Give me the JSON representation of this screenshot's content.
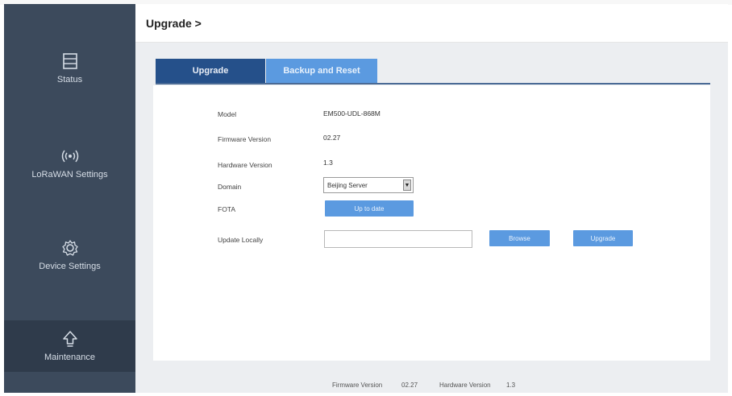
{
  "header": {
    "title": "Upgrade >"
  },
  "sidebar": {
    "items": [
      {
        "label": "Status",
        "icon": "status-icon"
      },
      {
        "label": "LoRaWAN Settings",
        "icon": "wireless-icon"
      },
      {
        "label": "Device Settings",
        "icon": "gear-icon"
      },
      {
        "label": "Maintenance",
        "icon": "upgrade-arrow-icon",
        "active": true
      }
    ]
  },
  "tabs": [
    {
      "label": "Upgrade",
      "active": true
    },
    {
      "label": "Backup and Reset",
      "active": false
    }
  ],
  "form": {
    "model_label": "Model",
    "model_value": "EM500-UDL-868M",
    "firmware_label": "Firmware Version",
    "firmware_value": "02.27",
    "hardware_label": "Hardware Version",
    "hardware_value": "1.3",
    "domain_label": "Domain",
    "domain_value": "Beijing Server",
    "fota_label": "FOTA",
    "fota_button": "Up to date",
    "update_label": "Update Locally",
    "browse_button": "Browse",
    "upgrade_button": "Upgrade"
  },
  "footer": {
    "firmware_label": "Firmware Version",
    "firmware_value": "02.27",
    "hardware_label": "Hardware Version",
    "hardware_value": "1.3"
  },
  "colors": {
    "sidebar_bg": "#3c4a5c",
    "tab_active": "#25508a",
    "tab_inactive": "#5b9ae0",
    "button": "#5b9ae0"
  }
}
